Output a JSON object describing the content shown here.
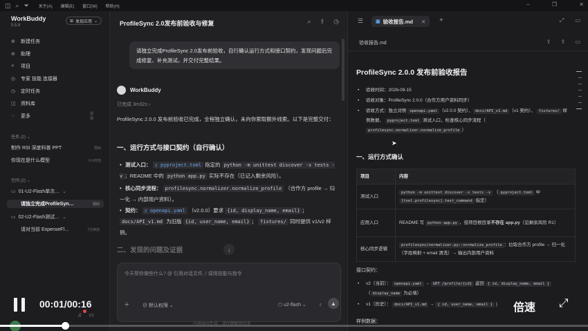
{
  "titlebar": {
    "menu": [
      "关于(A)",
      "编辑(E)",
      "窗口(W)",
      "帮助(H)"
    ]
  },
  "sidebar": {
    "app_name": "WorkBuddy",
    "version": "5.5.6",
    "app_button": "发现应用",
    "nav": [
      {
        "label": "新建任务",
        "icon": "plus-circle-icon"
      },
      {
        "label": "助理",
        "icon": "assistant-icon"
      },
      {
        "label": "项目",
        "icon": "project-icon"
      },
      {
        "label": "专家 技能 连接器",
        "icon": "expert-icon"
      },
      {
        "label": "定时任务",
        "icon": "clock-icon"
      },
      {
        "label": "资料库",
        "icon": "book-icon"
      },
      {
        "label": "更多",
        "icon": "more-icon",
        "sub": "混搭"
      }
    ],
    "tasks_header": "任务 (2)",
    "tasks": [
      {
        "label": "制作 RSI 深度科普 PPT",
        "time": "周四"
      },
      {
        "label": "你现在是什么模型",
        "time": "6小时前"
      }
    ],
    "groups": [
      {
        "label": "01-U2-Flash单次…"
      },
      {
        "label": "02-U2-Flash测试…"
      }
    ],
    "active_task": {
      "label": "请独立完成ProfileSyn…",
      "time": "周四"
    },
    "group2_task": {
      "label": "请对当前 ExpenseFl…",
      "time": "7分钟前"
    },
    "spaces_header": "空间 (2)"
  },
  "chat": {
    "title": "ProfileSync 2.0发布前验收与修复",
    "user_message": "请独立完成ProfileSync 2.0发布前验收，自行确认运行方式和接口契约，发现问题后完成修复、补充测试，并交付完整结果。",
    "bot_name": "WorkBuddy",
    "done": "已完成 3m32s",
    "summary": "ProfileSync 2.0.0 发布前验收已完成，全程独立确认，未向你索取额外线索。以下是完整交付：",
    "section1": "一、运行方式与接口契约（自行确认）",
    "b1": {
      "label": "测试入口：",
      "file": "pyproject.toml",
      "t1": "指定的",
      "code": "python -m unittest discover -s tests -v",
      "t2": "；README 中的",
      "code2": "python app.py",
      "t3": "实际不存在（已记入剩余风险）。"
    },
    "b2": {
      "label": "核心同步流程：",
      "code": "profilesync.normalizer.normalize_profile",
      "t1": "（合作方 profile → 归一化 → 内部用户资料）。"
    },
    "b3": {
      "label": "契约：",
      "file": "openapi.yaml",
      "t1": "（v2.0.0）要求",
      "code": "{id, display_name, email}",
      "t2": "；",
      "code2": "docs/API_v1.md",
      "t3": "为旧版",
      "code3": "{id, user_name, email}",
      "t4": "；",
      "code4": "fixtures/",
      "t5": "同时提供 v1/v2 样例。"
    },
    "section2": "二、发现的问题及证据",
    "input_placeholder": "今天帮你做些什么? @ 引用对话文件, / 调用技能与指令",
    "permission": "默认权限",
    "model": "u2-flash",
    "footnote": "内容由AI生成，请仔细甄别信息"
  },
  "doc": {
    "tab": "验收报告.md",
    "filename": "验收报告.md",
    "title": "ProfileSync 2.0.0 发布前验收报告",
    "meta": [
      {
        "label": "验收时间：",
        "value": "2026-09-15"
      },
      {
        "label": "验收对象：",
        "value": "ProfileSync 2.0.0（合作方用户资料同步）"
      }
    ],
    "method": {
      "label": "验收方式：独立对照",
      "c1": "openapi.yaml",
      "t1": "（v2.0.0 契约）、",
      "c2": "docs/API_v1.md",
      "t2": "（v1 契约）、",
      "c3": "fixtures/",
      "t3": "样例数据、",
      "c4": "pyproject.toml",
      "t4": "测试入口，检查核心同步流程（",
      "c5": "profilesync.normalizer.normalize_profile",
      "t5": "）"
    },
    "section1": "一、运行方式确认",
    "table": {
      "headers": [
        "项目",
        "内容"
      ],
      "rows": [
        {
          "item": "测试入口",
          "c1": "python -m unittest discover -s tests -v",
          "t1": "（",
          "c2": "pyproject.toml",
          "t2": "中",
          "c3": "[tool.profilesync].test_command",
          "t3": "指定）"
        },
        {
          "item": "应用入口",
          "t1": "README 写",
          "c1": "python app.py",
          "t2": "，但项目根目录",
          "bold": "不存在 app.py",
          "t3": "（见剩余风险 R1）"
        },
        {
          "item": "核心同步逻辑",
          "c1": "profilesync/normalizer.py::normalize_profile",
          "t1": "：拉取合作方 profile → 归一化（字段映射 + email 清洗）→ 输出内部用户资料"
        }
      ]
    },
    "contract_label": "接口契约：",
    "contracts": [
      {
        "label": "v2（当前）：",
        "c1": "openapi.yaml",
        "t1": "→",
        "c2": "GET /profile/{id}",
        "t2": "返回",
        "c3": "{ id, display_name, email }",
        "t3": "（",
        "c4": "display_name",
        "t4": "为必填）"
      },
      {
        "label": "v1（历史）：",
        "c1": "docs/API_v1.md",
        "t1": "→",
        "c2": "{ id, user_name, email }",
        "t2": ")"
      }
    ],
    "sample_label": "样例数据："
  },
  "video": {
    "time": "00:01/00:16",
    "speed": "倍速",
    "progress": 0.11
  }
}
